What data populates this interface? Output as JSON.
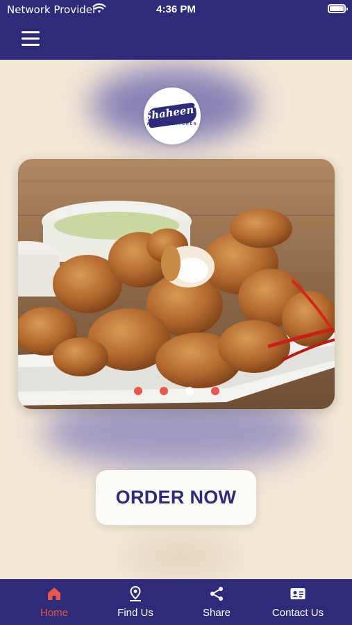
{
  "status_bar": {
    "carrier": "Network Provider",
    "time": "4:36 PM"
  },
  "logo": {
    "name": "Shaheen's",
    "tagline": "ANDHRA KITCHEN"
  },
  "slider": {
    "slide_count": 4,
    "active_index": 2
  },
  "order_button": {
    "label": "ORDER NOW"
  },
  "tabs": [
    {
      "label": "Home",
      "icon": "home-icon",
      "active": true
    },
    {
      "label": "Find Us",
      "icon": "location-pin-icon",
      "active": false
    },
    {
      "label": "Share",
      "icon": "share-icon",
      "active": false
    },
    {
      "label": "Contact Us",
      "icon": "contact-card-icon",
      "active": false
    }
  ],
  "colors": {
    "primary": "#2f2b7a",
    "accent": "#e8584a",
    "background": "#f3e8d6"
  }
}
